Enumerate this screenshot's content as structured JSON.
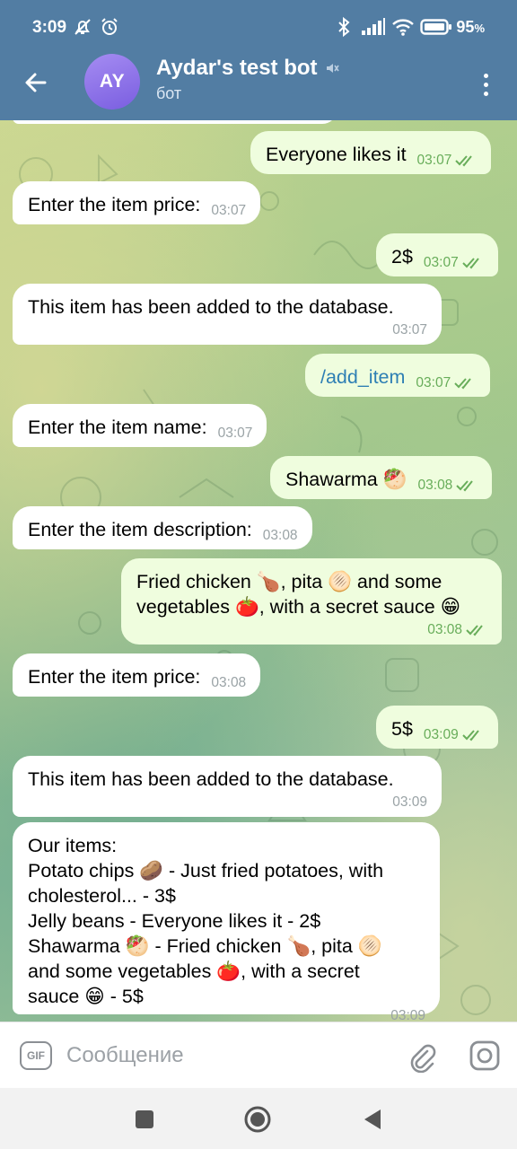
{
  "status_bar": {
    "time": "3:09",
    "battery": "95"
  },
  "header": {
    "avatar_initials": "AY",
    "title": "Aydar's test bot",
    "subtitle": "бот",
    "colors": {
      "bar": "#527da3",
      "avatar": "#8b6fe8"
    }
  },
  "messages": [
    {
      "dir": "out",
      "text": "Everyone likes it",
      "time": "03:07"
    },
    {
      "dir": "in",
      "text": "Enter the item price:",
      "time": "03:07"
    },
    {
      "dir": "out",
      "text": "2$",
      "time": "03:07"
    },
    {
      "dir": "in",
      "text": "This item has been added to the database.",
      "time": "03:07"
    },
    {
      "dir": "out",
      "text": "/add_item",
      "time": "03:07"
    },
    {
      "dir": "in",
      "text": "Enter the item name:",
      "time": "03:07"
    },
    {
      "dir": "out",
      "text": "Shawarma 🥙",
      "time": "03:08"
    },
    {
      "dir": "in",
      "text": "Enter the item description:",
      "time": "03:08"
    },
    {
      "dir": "out",
      "text": "Fried chicken 🍗, pita 🫓 and some\nvegetables 🍅, with a secret sauce 😁",
      "time": "03:08"
    },
    {
      "dir": "in",
      "text": "Enter the item price:",
      "time": "03:08"
    },
    {
      "dir": "out",
      "text": "5$",
      "time": "03:09"
    },
    {
      "dir": "in",
      "text": "This item has been added to the database.",
      "time": "03:09"
    },
    {
      "dir": "in",
      "text": "Our items:\nPotato chips 🥔 - Just fried potatoes, with\ncholesterol... - 3$\nJelly beans - Everyone likes it - 2$\nShawarma 🥙 - Fried chicken 🍗, pita 🫓\nand some vegetables 🍅, with a secret\nsauce 😁 - 5$",
      "time": "03:09"
    }
  ],
  "input_bar": {
    "gif_label": "GIF",
    "placeholder": "Сообщение"
  },
  "colors": {
    "incoming_bubble": "#ffffff",
    "outgoing_bubble": "#effdde",
    "outgoing_meta": "#68ad5a",
    "link": "#2e7fb4"
  },
  "icons": {
    "back": "arrow-left-icon",
    "muted": "speaker-muted-icon",
    "menu": "more-vertical-icon",
    "attach": "paperclip-icon",
    "camera": "instagram-camera-icon",
    "read": "double-check-icon"
  }
}
